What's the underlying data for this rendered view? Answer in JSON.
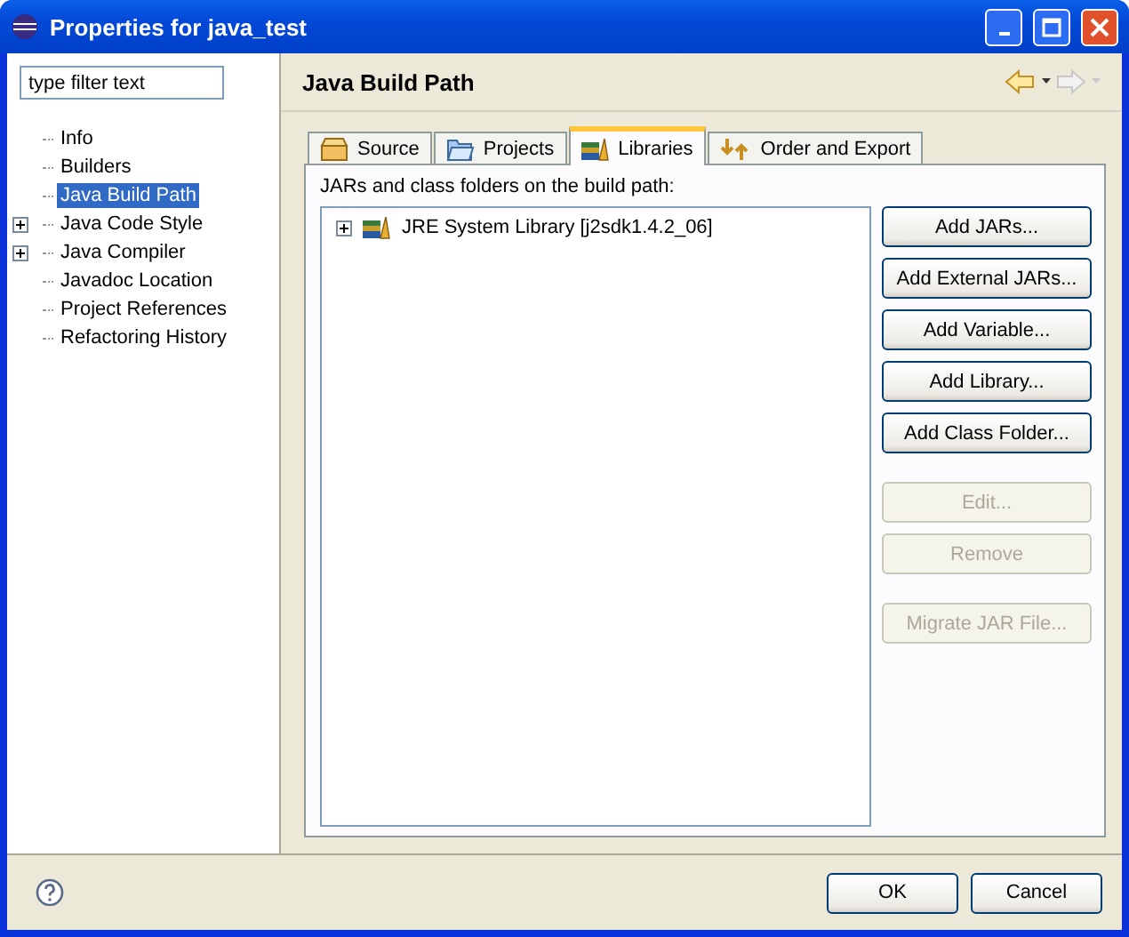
{
  "window": {
    "title": "Properties for java_test"
  },
  "filter": {
    "placeholder": "type filter text"
  },
  "tree": [
    {
      "label": "Info",
      "kind": "leaf",
      "selected": false
    },
    {
      "label": "Builders",
      "kind": "leaf",
      "selected": false
    },
    {
      "label": "Java Build Path",
      "kind": "leaf",
      "selected": true
    },
    {
      "label": "Java Code Style",
      "kind": "folder",
      "selected": false
    },
    {
      "label": "Java Compiler",
      "kind": "folder",
      "selected": false
    },
    {
      "label": "Javadoc Location",
      "kind": "leaf",
      "selected": false
    },
    {
      "label": "Project References",
      "kind": "leaf",
      "selected": false
    },
    {
      "label": "Refactoring History",
      "kind": "leaf",
      "selected": false
    }
  ],
  "page_title": "Java Build Path",
  "tabs": [
    {
      "label": "Source",
      "selected": false
    },
    {
      "label": "Projects",
      "selected": false
    },
    {
      "label": "Libraries",
      "selected": true
    },
    {
      "label": "Order and Export",
      "selected": false
    }
  ],
  "list_label": "JARs and class folders on the build path:",
  "libraries": [
    {
      "label": "JRE System Library [j2sdk1.4.2_06]",
      "expanded": false
    }
  ],
  "button_groups": [
    [
      {
        "label": "Add JARs...",
        "disabled": false
      },
      {
        "label": "Add External JARs...",
        "disabled": false
      },
      {
        "label": "Add Variable...",
        "disabled": false
      },
      {
        "label": "Add Library...",
        "disabled": false
      },
      {
        "label": "Add Class Folder...",
        "disabled": false
      }
    ],
    [
      {
        "label": "Edit...",
        "disabled": true
      },
      {
        "label": "Remove",
        "disabled": true
      }
    ],
    [
      {
        "label": "Migrate JAR File...",
        "disabled": true
      }
    ]
  ],
  "footer_buttons": [
    "OK",
    "Cancel"
  ]
}
